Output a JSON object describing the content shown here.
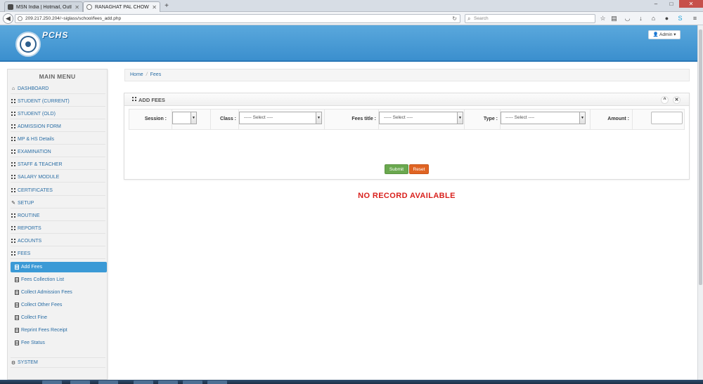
{
  "browser": {
    "tabs": [
      {
        "title": "MSN India | Hotmail, Outlo...",
        "active": false
      },
      {
        "title": "RANAGHAT PAL CHOWD...",
        "active": true
      }
    ],
    "new_tab": "+",
    "url": "209.217.250.204/~siglass/school/fees_add.php",
    "search_placeholder": "Search",
    "window_controls": {
      "minimize": "–",
      "maximize": "□",
      "close": "✕"
    }
  },
  "header": {
    "brand": "PCHS",
    "user_button": "Admin"
  },
  "sidebar": {
    "title": "MAIN MENU",
    "items": [
      {
        "label": "DASHBOARD",
        "icon": "home-icon"
      },
      {
        "label": "STUDENT (CURRENT)",
        "icon": "grid-icon"
      },
      {
        "label": "STUDENT (OLD)",
        "icon": "grid-icon"
      },
      {
        "label": "ADMISSION FORM",
        "icon": "grid-icon"
      },
      {
        "label": "MP & HS Details",
        "icon": "grid-icon"
      },
      {
        "label": "EXAMINATION",
        "icon": "grid-icon"
      },
      {
        "label": "STAFF & TEACHER",
        "icon": "grid-icon"
      },
      {
        "label": "SALARY MODULE",
        "icon": "grid-icon"
      },
      {
        "label": "CERTIFICATES",
        "icon": "grid-icon"
      },
      {
        "label": "SETUP",
        "icon": "wrench-icon"
      },
      {
        "label": "ROUTINE",
        "icon": "grid-icon"
      },
      {
        "label": "REPORTS",
        "icon": "grid-icon"
      },
      {
        "label": "ACOUNTS",
        "icon": "grid-icon"
      },
      {
        "label": "FEES",
        "icon": "grid-icon"
      }
    ],
    "sub_items": [
      {
        "label": "Add Fees",
        "active": true
      },
      {
        "label": "Fees Collection List",
        "active": false
      },
      {
        "label": "Collect Admission Fees",
        "active": false
      },
      {
        "label": "Collect Other Fees",
        "active": false
      },
      {
        "label": "Collect Fine",
        "active": false
      },
      {
        "label": "Reprint Fees Receipt",
        "active": false
      },
      {
        "label": "Fee Status",
        "active": false
      }
    ],
    "system_item": {
      "label": "SYSTEM",
      "icon": "cogs-icon"
    }
  },
  "breadcrumb": {
    "home": "Home",
    "separator": "/",
    "current": "Fees"
  },
  "panel": {
    "title": "ADD FEES",
    "collapse": "^",
    "close": "✕",
    "form": {
      "session_label": "Session :",
      "session_value": "",
      "class_label": "Class :",
      "class_value": "----- Select ----",
      "fees_title_label": "Fees title :",
      "fees_title_value": "----- Select ----",
      "type_label": "Type :",
      "type_value": "----- Select ----",
      "amount_label": "Amount :",
      "amount_value": ""
    },
    "submit_label": "Submit",
    "reset_label": "Reset",
    "empty_message": "NO RECORD AVAILABLE"
  },
  "colors": {
    "header_blue": "#3b8fce",
    "active_item": "#3b9ad6",
    "submit_green": "#6aa84f",
    "reset_orange": "#e06423",
    "empty_red": "#d9201c"
  }
}
